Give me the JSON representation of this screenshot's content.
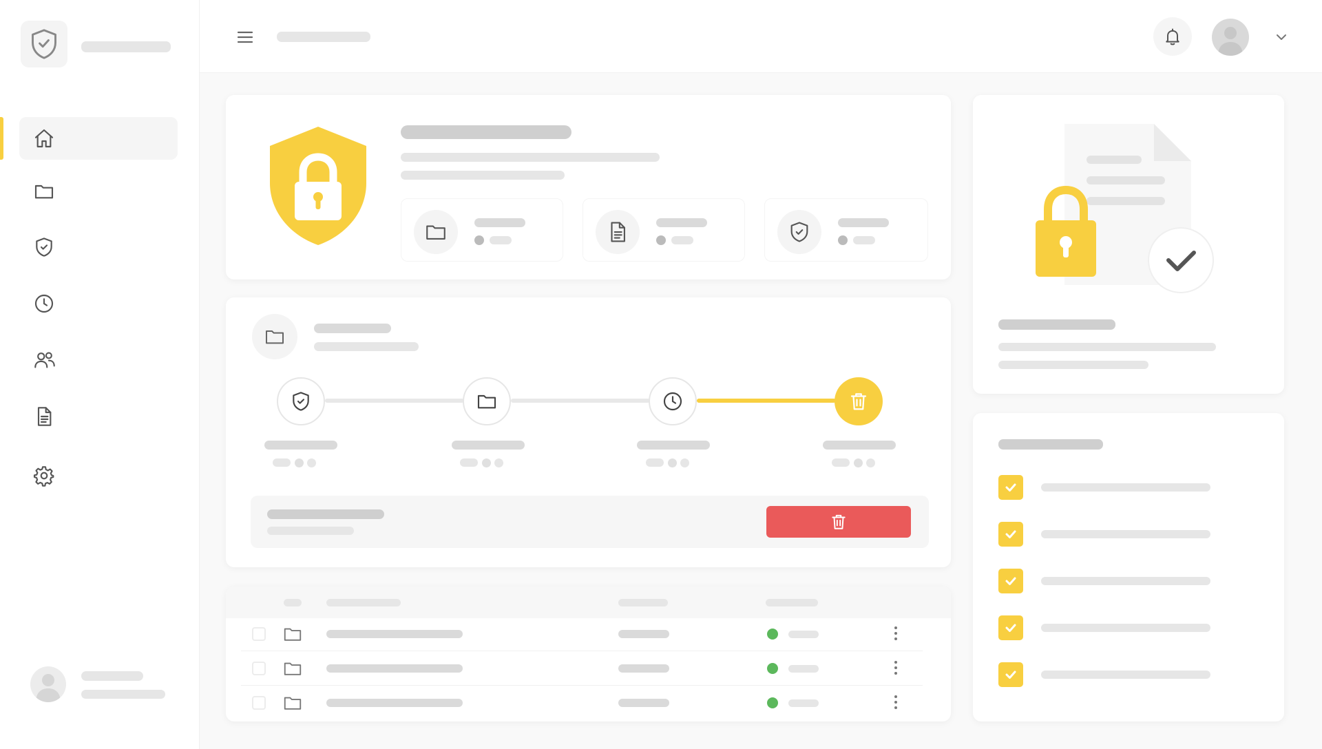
{
  "colors": {
    "accent": "#f8cf40",
    "danger": "#ea5a5a",
    "success": "#5cb85c",
    "skeleton": "#e6e6e6"
  },
  "sidebar": {
    "logo_icon": "shield-check-icon",
    "items": [
      {
        "name": "home",
        "icon": "home-icon",
        "active": true
      },
      {
        "name": "folders",
        "icon": "folder-icon",
        "active": false
      },
      {
        "name": "security",
        "icon": "shield-check-icon",
        "active": false
      },
      {
        "name": "history",
        "icon": "clock-icon",
        "active": false
      },
      {
        "name": "users",
        "icon": "users-icon",
        "active": false
      },
      {
        "name": "documents",
        "icon": "document-icon",
        "active": false
      },
      {
        "name": "settings",
        "icon": "gear-icon",
        "active": false
      }
    ]
  },
  "topbar": {
    "menu_icon": "hamburger-icon",
    "notification_icon": "bell-icon",
    "dropdown_icon": "chevron-down-icon"
  },
  "hero": {
    "icon": "shield-lock-icon",
    "stats": [
      {
        "icon": "folder-icon"
      },
      {
        "icon": "document-icon"
      },
      {
        "icon": "shield-check-icon"
      }
    ]
  },
  "workflow": {
    "steps": [
      {
        "icon": "shield-check-icon",
        "active": false
      },
      {
        "icon": "folder-icon",
        "active": false
      },
      {
        "icon": "clock-icon",
        "active": false
      },
      {
        "icon": "trash-icon",
        "active": true
      }
    ],
    "action_icon": "trash-icon"
  },
  "table": {
    "rows": [
      {
        "icon": "folder-icon",
        "status": "green"
      },
      {
        "icon": "folder-icon",
        "status": "green"
      },
      {
        "icon": "folder-icon",
        "status": "green"
      }
    ]
  },
  "checklist": {
    "items": [
      {
        "checked": true
      },
      {
        "checked": true
      },
      {
        "checked": true
      },
      {
        "checked": true
      },
      {
        "checked": true
      }
    ]
  }
}
